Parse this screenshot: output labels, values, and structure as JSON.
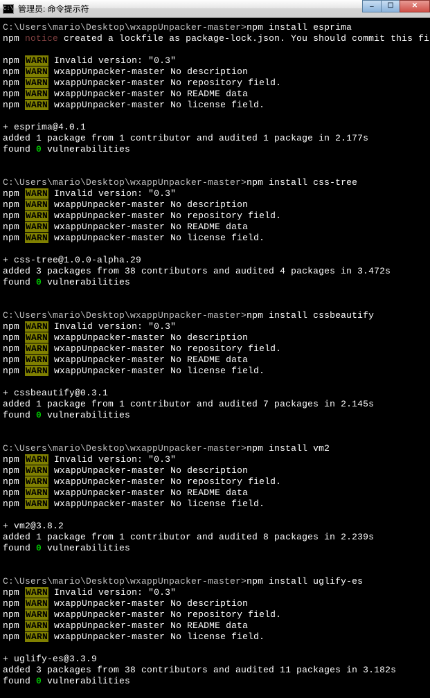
{
  "title": "管理员: 命令提示符",
  "prompt_path": "C:\\Users\\mario\\Desktop\\wxappUnpacker-master>",
  "npm_label": "npm",
  "notice_label": "notice",
  "warn_label": "WARN",
  "sessions": [
    {
      "cmd": "npm install esprima",
      "warns": [
        " Invalid version: \"0.3\"",
        " wxappUnpacker-master No description",
        " wxappUnpacker-master No repository field.",
        " wxappUnpacker-master No README data",
        " wxappUnpacker-master No license field."
      ],
      "notice": " created a lockfile as package-lock.json. You should commit this fil",
      "pkg": "+ esprima@4.0.1",
      "added": "added 1 package from 1 contributor and audited 1 package in 2.177s",
      "vuln_post": " vulnerabilities"
    },
    {
      "cmd": "npm install css-tree",
      "warns": [
        " Invalid version: \"0.3\"",
        " wxappUnpacker-master No description",
        " wxappUnpacker-master No repository field.",
        " wxappUnpacker-master No README data",
        " wxappUnpacker-master No license field."
      ],
      "pkg": "+ css-tree@1.0.0-alpha.29",
      "added": "added 3 packages from 38 contributors and audited 4 packages in 3.472s",
      "vuln_post": " vulnerabilities"
    },
    {
      "cmd": "npm install cssbeautify",
      "warns": [
        " Invalid version: \"0.3\"",
        " wxappUnpacker-master No description",
        " wxappUnpacker-master No repository field.",
        " wxappUnpacker-master No README data",
        " wxappUnpacker-master No license field."
      ],
      "pkg": "+ cssbeautify@0.3.1",
      "added": "added 1 package from 1 contributor and audited 7 packages in 2.145s",
      "vuln_post": " vulnerabilities"
    },
    {
      "cmd": "npm install vm2",
      "warns": [
        " Invalid version: \"0.3\"",
        " wxappUnpacker-master No description",
        " wxappUnpacker-master No repository field.",
        " wxappUnpacker-master No README data",
        " wxappUnpacker-master No license field."
      ],
      "pkg": "+ vm2@3.8.2",
      "added": "added 1 package from 1 contributor and audited 8 packages in 2.239s",
      "vuln_post": " vulnerabilities"
    },
    {
      "cmd": "npm install uglify-es",
      "warns": [
        " Invalid version: \"0.3\"",
        " wxappUnpacker-master No description",
        " wxappUnpacker-master No repository field.",
        " wxappUnpacker-master No README data",
        " wxappUnpacker-master No license field."
      ],
      "pkg": "+ uglify-es@3.3.9",
      "added": "added 3 packages from 38 contributors and audited 11 packages in 3.182s",
      "vuln_post": " vulnerabilities"
    }
  ],
  "found_label": "found ",
  "vuln_count": "0"
}
